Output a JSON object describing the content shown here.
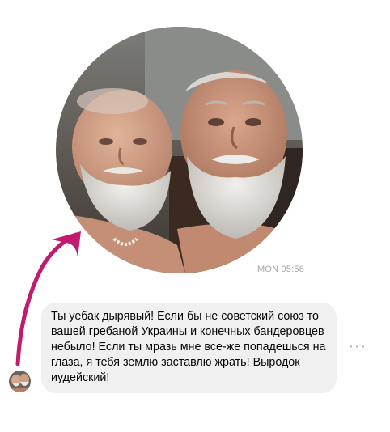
{
  "conversation": {
    "photo_message": {
      "shape": "circle",
      "subject": "photo-of-two-bearded-elderly-men"
    },
    "timestamp": "MON 05:56",
    "annotation": {
      "kind": "arrow",
      "color": "#c21a6e",
      "points_to": "photo-message"
    },
    "text_message": {
      "text": "Ты уебак дырявый! Если бы не советский союз то вашей гребаной Украины и конечных бандеровцев небыло! Если ты мразь мне все-же попадешься на глаза, я тебя землю заставлю жрать! Выродок иудейский!",
      "bubble_color": "#f1f0f0",
      "text_color": "#050505"
    },
    "sender_avatar": {
      "icon": "sender-avatar"
    },
    "more_options": {
      "icon": "more-horizontal-icon"
    }
  }
}
